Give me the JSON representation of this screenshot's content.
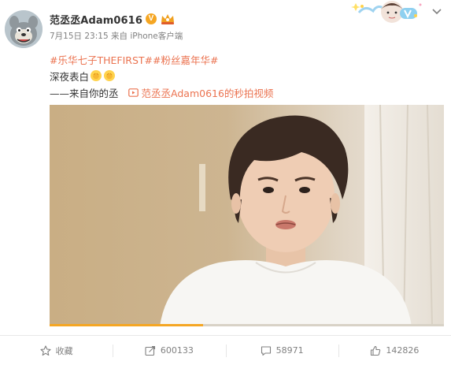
{
  "author": {
    "name": "范丞丞Adam0616",
    "verified_mark": "V"
  },
  "meta": {
    "date": "7月15日 23:15",
    "source": "来自 iPhone客户端"
  },
  "post": {
    "hashtags": [
      "#乐华七子THEFIRST#",
      "#粉丝嘉年华#"
    ],
    "text_line1": "深夜表白",
    "text_line2": "——来自你的丞",
    "video_link": "范丞丞Adam0616的秒拍视频"
  },
  "video": {
    "progress_fraction": 0.39
  },
  "actions": {
    "favorite_label": "收藏",
    "repost_count": "600133",
    "comment_count": "58971",
    "like_count": "142826"
  },
  "colors": {
    "link": "#eb7350",
    "verified": "#f5a623",
    "muted": "#808080"
  },
  "icons": [
    "avatar",
    "verified-badge",
    "fan-crown-badge",
    "dropdown-chevron-icon",
    "clap-emoji",
    "video-icon",
    "star-icon",
    "repost-icon",
    "comment-icon",
    "thumbs-up-icon"
  ]
}
